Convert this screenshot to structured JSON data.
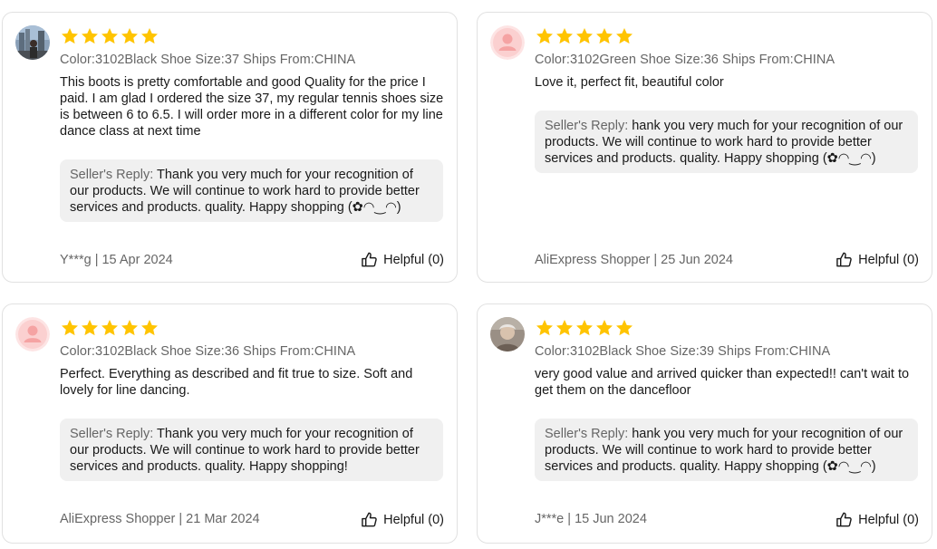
{
  "colors": {
    "star": "#ffc400",
    "secondary_text": "#666666",
    "reply_bg": "#f0f0f0"
  },
  "reviews": [
    {
      "rating": 5,
      "avatar": "user-photo-icon",
      "sku": "Color:3102Black Shoe Size:37 Ships From:CHINA",
      "text": "This boots is pretty comfortable and good Quality for the price I paid. I am glad I ordered the size 37, my regular tennis shoes size is between 6 to 6.5. I will order more in a different color for my line dance class at next time",
      "reply_label": "Seller's Reply:",
      "reply_text": " Thank you very much for your recognition of our products. We will continue to work hard to provide better services and products. quality. Happy shopping (✿◠‿◠)",
      "meta": "Y***g | 15 Apr 2024",
      "helpful": "Helpful (0)"
    },
    {
      "rating": 5,
      "avatar": "default-avatar-icon",
      "sku": "Color:3102Green Shoe Size:36 Ships From:CHINA",
      "text": "Love it, perfect fit, beautiful color",
      "reply_label": "Seller's Reply:",
      "reply_text": " hank you very much for your recognition of our products. We will continue to work hard to provide better services and products. quality. Happy shopping (✿◠‿◠)",
      "meta": "AliExpress Shopper | 25 Jun 2024",
      "helpful": "Helpful (0)"
    },
    {
      "rating": 5,
      "avatar": "default-avatar-icon",
      "sku": "Color:3102Black Shoe Size:36 Ships From:CHINA",
      "text": "Perfect. Everything as described and fit true to size. Soft and lovely for line dancing.",
      "reply_label": "Seller's Reply:",
      "reply_text": " Thank you very much for your recognition of our products. We will continue to work hard to provide better services and products. quality. Happy shopping!",
      "meta": "AliExpress Shopper | 21 Mar 2024",
      "helpful": "Helpful (0)"
    },
    {
      "rating": 5,
      "avatar": "user-photo-icon",
      "sku": "Color:3102Black Shoe Size:39 Ships From:CHINA",
      "text": "very good value and arrived quicker than expected!! can't wait to get them on the dancefloor",
      "reply_label": "Seller's Reply:",
      "reply_text": " hank you very much for your recognition of our products. We will continue to work hard to provide better services and products. quality. Happy shopping (✿◠‿◠)",
      "meta": "J***e | 15 Jun 2024",
      "helpful": "Helpful (0)"
    }
  ]
}
